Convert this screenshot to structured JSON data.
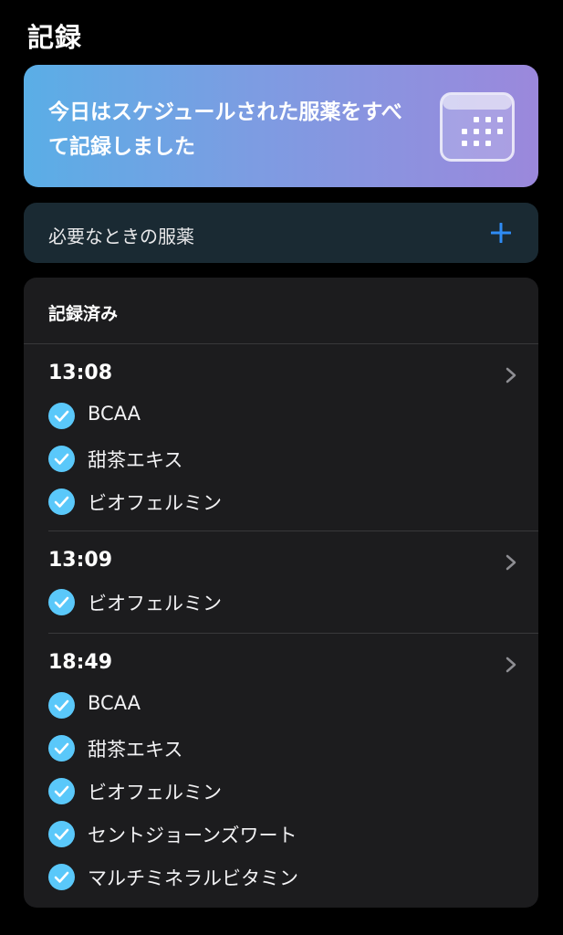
{
  "page": {
    "title": "記録"
  },
  "banner": {
    "message": "今日はスケジュールされた服薬をすべて記録しました",
    "icon": "calendar-icon"
  },
  "as_needed": {
    "label": "必要なときの服薬",
    "icon": "plus-icon"
  },
  "log": {
    "header": "記録済み",
    "groups": [
      {
        "time": "13:08",
        "items": [
          "BCAA",
          "甜茶エキス",
          "ビオフェルミン"
        ]
      },
      {
        "time": "13:09",
        "items": [
          "ビオフェルミン"
        ]
      },
      {
        "time": "18:49",
        "items": [
          "BCAA",
          "甜茶エキス",
          "ビオフェルミン",
          "セントジョーンズワート",
          "マルチミネラルビタミン"
        ]
      }
    ]
  },
  "colors": {
    "accent": "#2f8cf5",
    "check": "#5ac8fa",
    "card": "#1c1c1e",
    "background": "#000000"
  }
}
